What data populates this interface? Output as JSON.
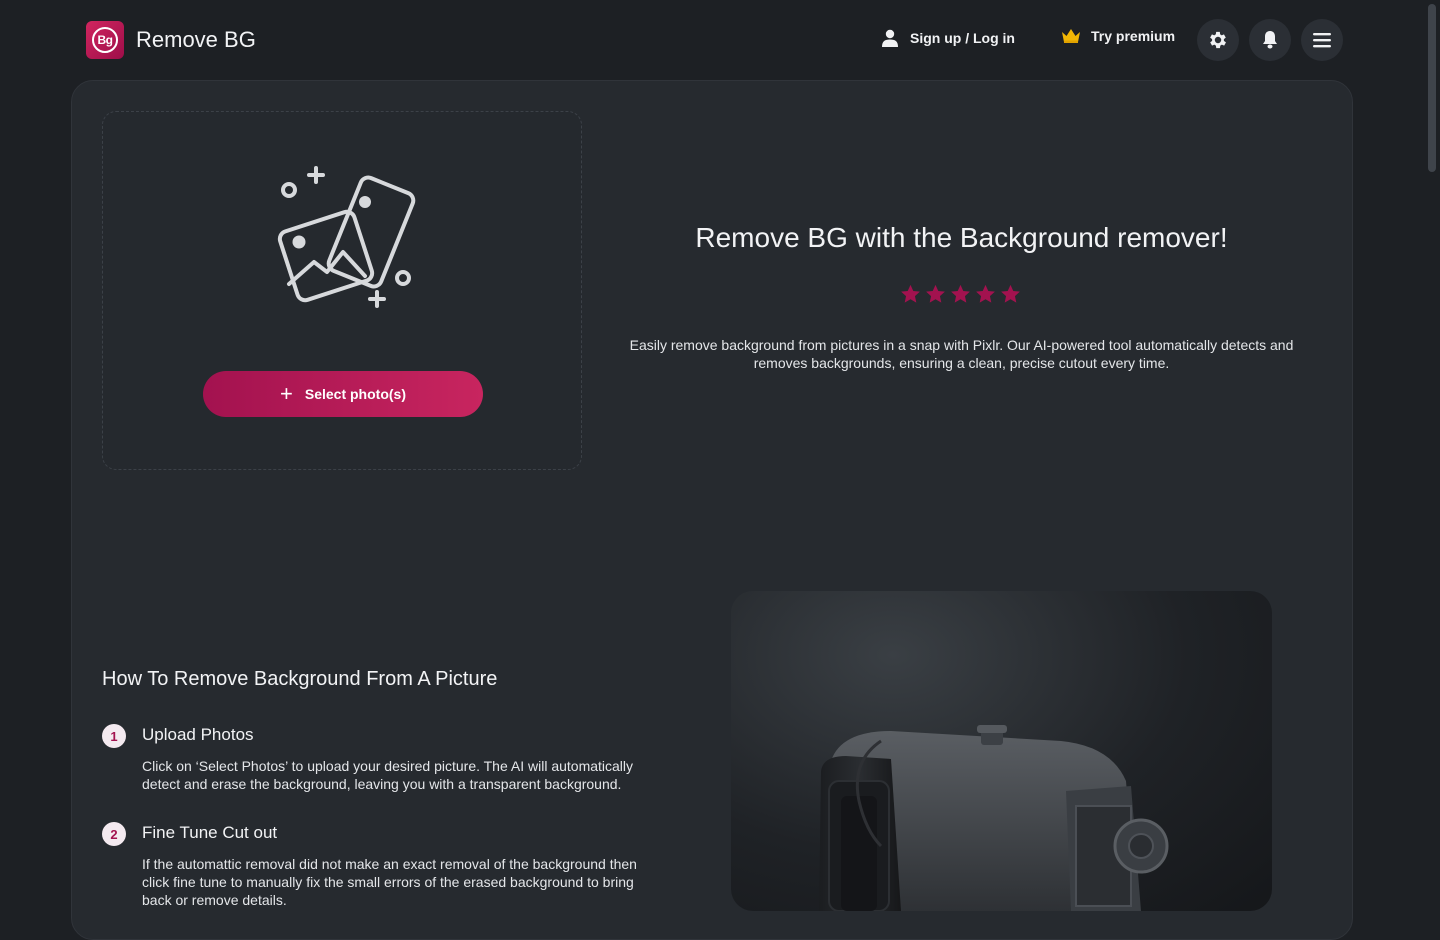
{
  "header": {
    "logo_text": "Bg",
    "app_name": "Remove BG",
    "signup_label": "Sign up / Log in",
    "premium_label": "Try premium",
    "user_icon": "user-icon",
    "crown_icon": "crown-icon",
    "settings_icon": "gear-icon",
    "notifications_icon": "bell-icon",
    "menu_icon": "hamburger-menu-icon"
  },
  "upload": {
    "button_label": "Select photo(s)",
    "illustration_icon": "photos-illustration-icon"
  },
  "hero": {
    "title": "Remove BG with the Background remover!",
    "rating": 5,
    "rating_max": 5,
    "description": "Easily remove background from pictures in a snap with Pixlr. Our AI-powered tool automatically detects and removes backgrounds, ensuring a clean, precise cutout every time."
  },
  "howto": {
    "title": "How To Remove Background From A Picture",
    "steps": [
      {
        "number": "1",
        "title": "Upload Photos",
        "description": "Click on ‘Select Photos’ to upload your desired picture. The AI will automatically detect and erase the background, leaving you with a transparent background."
      },
      {
        "number": "2",
        "title": "Fine Tune Cut out",
        "description": "If the automattic removal did not make an exact removal of the background then click fine tune to manually fix the small errors of the erased background to bring back or remove details."
      }
    ]
  },
  "colors": {
    "accent": "#c8255f",
    "accent_dark": "#a3124f",
    "star": "#a3124f",
    "background": "#1d2024",
    "card": "#262a2f"
  }
}
